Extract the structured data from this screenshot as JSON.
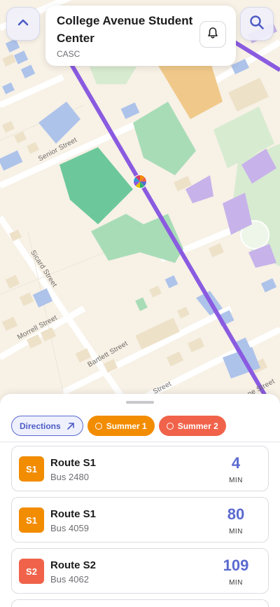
{
  "stop": {
    "name": "College Avenue Student Center",
    "code": "CASC"
  },
  "map": {
    "streets": [
      "Senior Street",
      "Sicard Street",
      "Morrell Street",
      "Bartlett Street",
      "Street",
      "ne Street"
    ]
  },
  "filters": [
    {
      "label": "Directions",
      "icon": "arrow-up-right-icon"
    },
    {
      "label": "Summer 1",
      "color": "#f28c00"
    },
    {
      "label": "Summer 2",
      "color": "#f0634a"
    }
  ],
  "arrivals": [
    {
      "badge": "S1",
      "badge_color": "#f28c00",
      "route": "Route S1",
      "bus": "Bus 2480",
      "eta": "4",
      "unit": "MIN"
    },
    {
      "badge": "S1",
      "badge_color": "#f28c00",
      "route": "Route S1",
      "bus": "Bus 4059",
      "eta": "80",
      "unit": "MIN"
    },
    {
      "badge": "S2",
      "badge_color": "#f0634a",
      "route": "Route S2",
      "bus": "Bus 4062",
      "eta": "109",
      "unit": "MIN"
    }
  ],
  "colors": {
    "accent": "#5b6ad0",
    "route_line": "#8a5be0"
  }
}
